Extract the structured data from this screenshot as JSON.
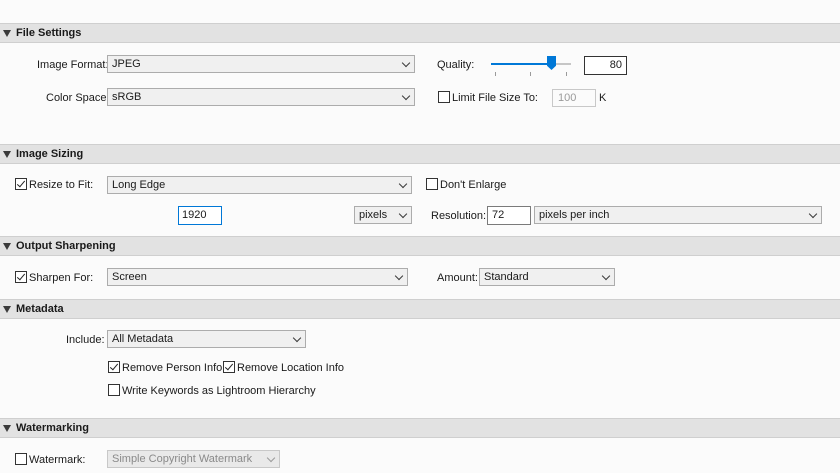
{
  "file_settings": {
    "header": "File Settings",
    "image_format_label": "Image Format:",
    "image_format_value": "JPEG",
    "quality_label": "Quality:",
    "quality_value": "80",
    "quality_level": 0.8,
    "color_space_label": "Color Space:",
    "color_space_value": "sRGB",
    "limit_file_size_label": "Limit File Size To:",
    "limit_file_size_checked": false,
    "limit_file_size_value": "100",
    "limit_file_size_unit": "K"
  },
  "image_sizing": {
    "header": "Image Sizing",
    "resize_label": "Resize to Fit:",
    "resize_checked": true,
    "resize_value": "Long Edge",
    "dont_enlarge_label": "Don't Enlarge",
    "dont_enlarge_checked": false,
    "size_value": "1920",
    "size_unit": "pixels",
    "resolution_label": "Resolution:",
    "resolution_value": "72",
    "resolution_unit": "pixels per inch"
  },
  "output_sharpening": {
    "header": "Output Sharpening",
    "sharpen_label": "Sharpen For:",
    "sharpen_checked": true,
    "sharpen_value": "Screen",
    "amount_label": "Amount:",
    "amount_value": "Standard"
  },
  "metadata": {
    "header": "Metadata",
    "include_label": "Include:",
    "include_value": "All Metadata",
    "remove_person_label": "Remove Person Info",
    "remove_person_checked": true,
    "remove_location_label": "Remove Location Info",
    "remove_location_checked": true,
    "write_keywords_label": "Write Keywords as Lightroom Hierarchy",
    "write_keywords_checked": false
  },
  "watermarking": {
    "header": "Watermarking",
    "watermark_label": "Watermark:",
    "watermark_checked": false,
    "watermark_value": "Simple Copyright Watermark"
  },
  "colors": {
    "accent": "#0078d7",
    "header_bg": "#e2e2e2",
    "panel_bg": "#fbfbfb"
  },
  "icons": {
    "collapse": "triangle-down-icon",
    "dropdown": "chevron-down-icon",
    "check": "checkmark-icon"
  }
}
